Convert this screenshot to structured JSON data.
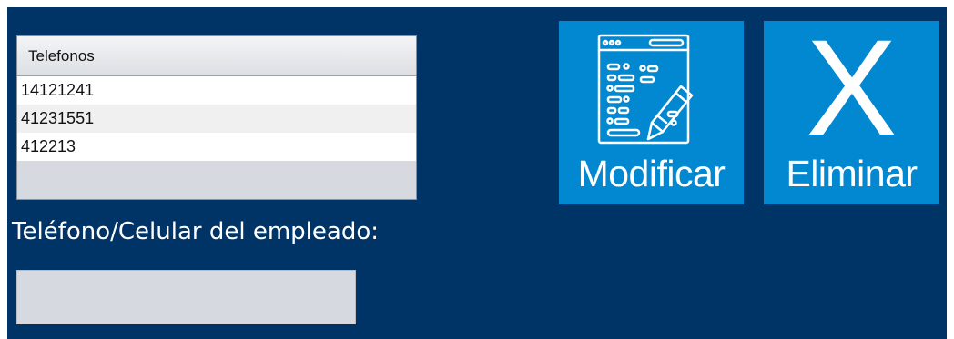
{
  "phones_table": {
    "header": "Telefonos",
    "rows": [
      "14121241",
      "41231551",
      "412213"
    ]
  },
  "employee_phone": {
    "label": "Teléfono/Celular del empleado:",
    "value": "",
    "placeholder": ""
  },
  "buttons": {
    "modify_label": "Modificar",
    "delete_glyph": "X",
    "delete_label": "Eliminar"
  },
  "icons": {
    "modify": "code-window-edit-icon",
    "delete": "close-icon"
  },
  "colors": {
    "background": "#003366",
    "button": "#0288d1",
    "field": "#d6d9df",
    "text_light": "#ffffff"
  }
}
